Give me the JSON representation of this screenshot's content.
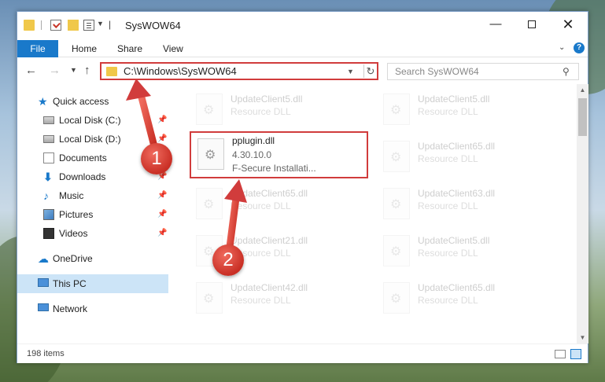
{
  "window": {
    "title": "SysWOW64",
    "controls": {
      "minimize": "—",
      "close": "✕"
    }
  },
  "ribbon": {
    "tabs": [
      "File",
      "Home",
      "Share",
      "View"
    ]
  },
  "navigation": {
    "address": "C:\\Windows\\SysWOW64",
    "search_placeholder": "Search SysWOW64"
  },
  "sidebar": {
    "items": [
      {
        "label": "Quick access",
        "icon": "star-icon"
      },
      {
        "label": "Local Disk (C:)",
        "icon": "disk-icon",
        "pinned": true
      },
      {
        "label": "Local Disk (D:)",
        "icon": "disk-icon",
        "pinned": true
      },
      {
        "label": "Documents",
        "icon": "documents-icon",
        "pinned": true
      },
      {
        "label": "Downloads",
        "icon": "download-icon",
        "pinned": true
      },
      {
        "label": "Music",
        "icon": "music-icon",
        "pinned": true
      },
      {
        "label": "Pictures",
        "icon": "pictures-icon",
        "pinned": true
      },
      {
        "label": "Videos",
        "icon": "videos-icon",
        "pinned": true
      },
      {
        "label": "OneDrive",
        "icon": "cloud-icon"
      },
      {
        "label": "This PC",
        "icon": "computer-icon",
        "selected": true
      },
      {
        "label": "Network",
        "icon": "network-icon"
      }
    ]
  },
  "files": [
    {
      "name": "UpdateClient5.dll",
      "type": "Resource DLL"
    },
    {
      "name": "UpdateClient5.dll",
      "type": "Resource DLL"
    },
    {
      "name": "pplugin.dll",
      "type": "4.30.10.0",
      "desc": "F-Secure Installati...",
      "highlighted": true
    },
    {
      "name": "UpdateClient65.dll",
      "type": "Resource DLL"
    },
    {
      "name": "UpdateClient65.dll",
      "type": "Resource DLL"
    },
    {
      "name": "UpdateClient63.dll",
      "type": "Resource DLL"
    },
    {
      "name": "UpdateClient21.dll",
      "type": "Resource DLL"
    },
    {
      "name": "UpdateClient5.dll",
      "type": "Resource DLL"
    },
    {
      "name": "UpdateClient42.dll",
      "type": "Resource DLL"
    },
    {
      "name": "UpdateClient65.dll",
      "type": "Resource DLL"
    }
  ],
  "status": {
    "item_count": "198 items"
  },
  "annotations": {
    "step1": "1",
    "step2": "2",
    "color": "#d13c3c"
  }
}
